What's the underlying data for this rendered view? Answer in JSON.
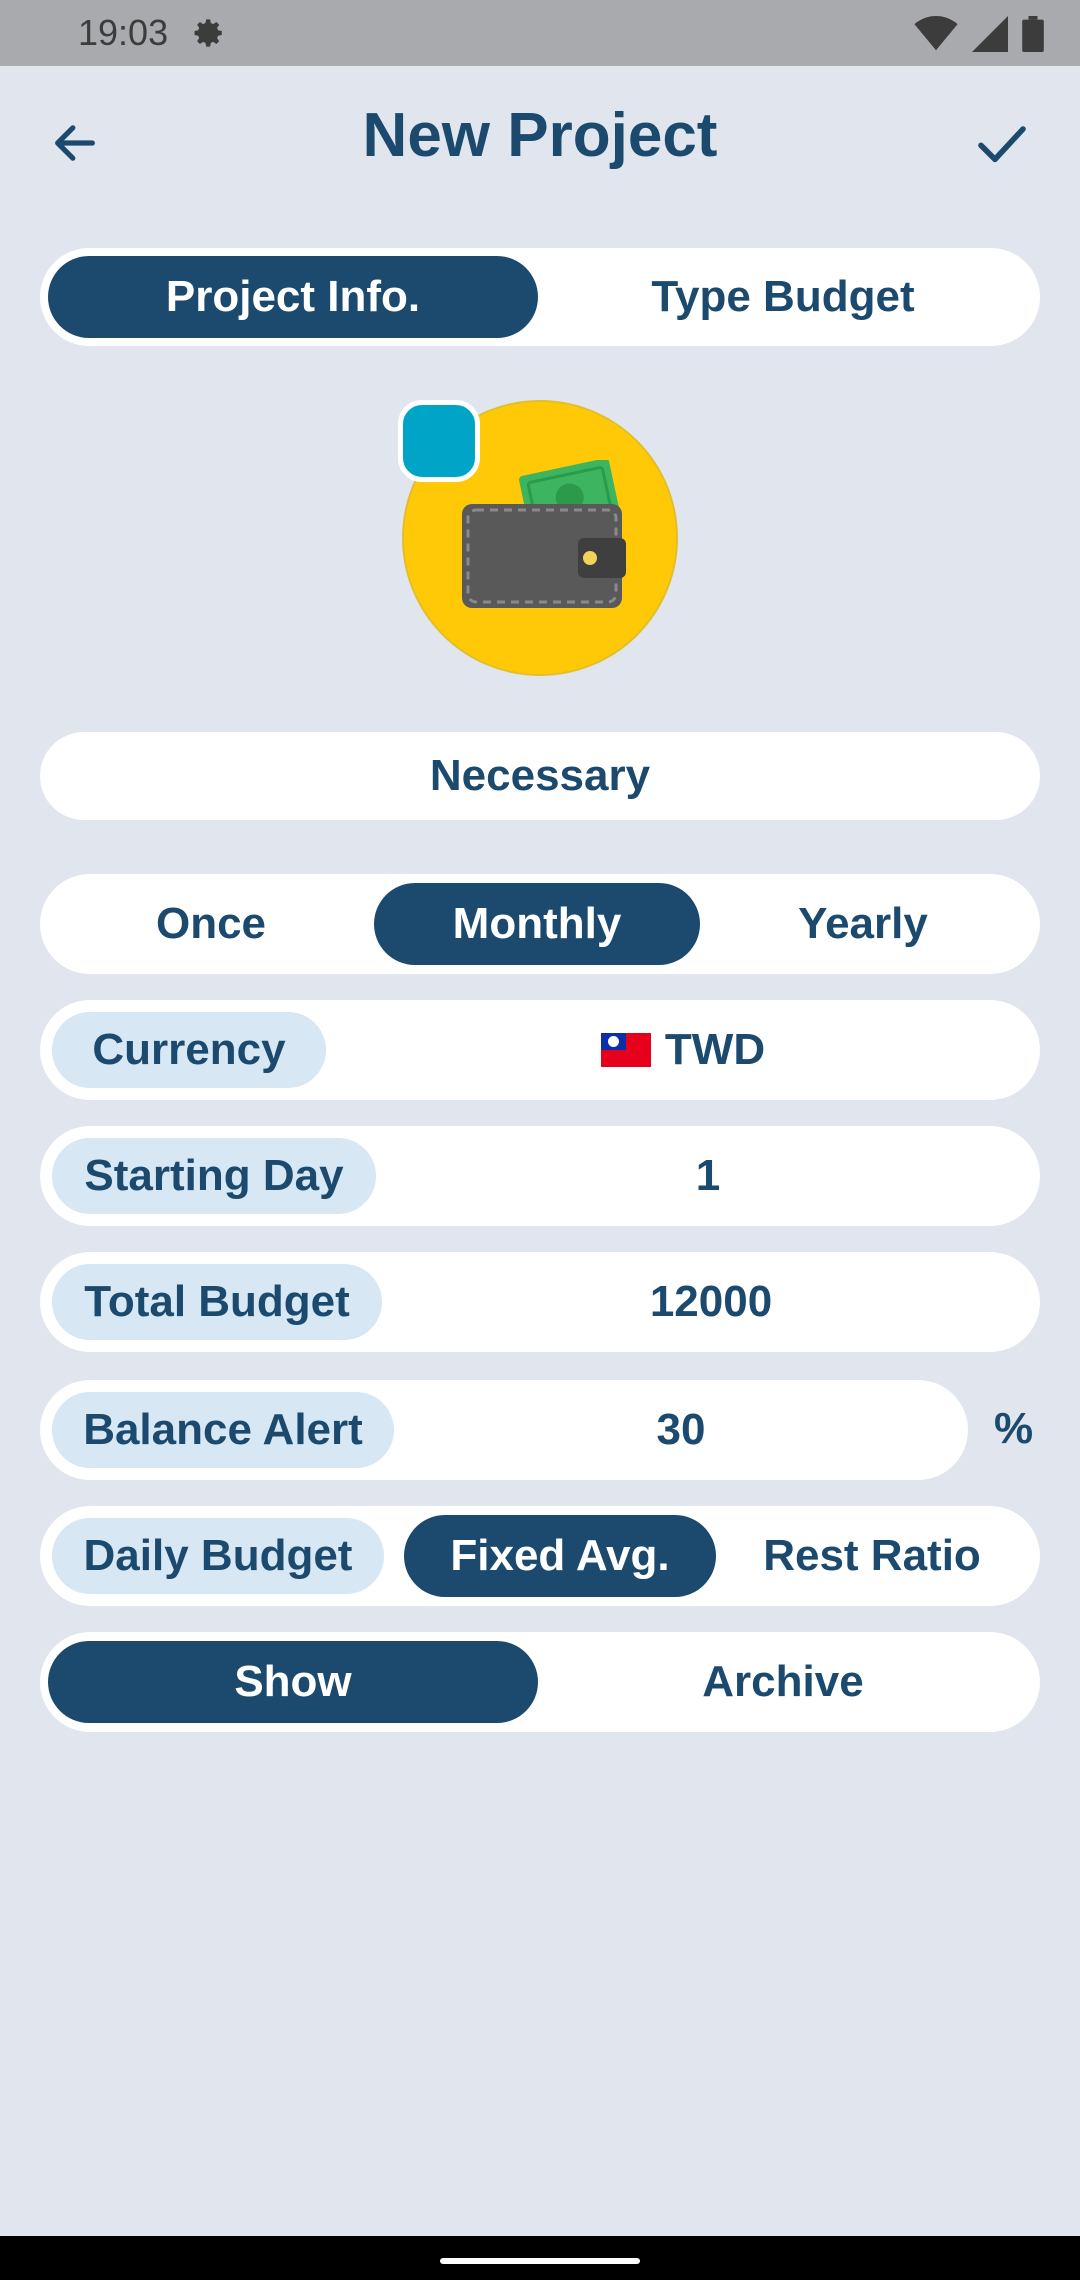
{
  "status_bar": {
    "time": "19:03"
  },
  "header": {
    "title": "New Project"
  },
  "top_tabs": {
    "items": [
      "Project Info.",
      "Type Budget"
    ],
    "active_index": 0
  },
  "project": {
    "name": "Necessary",
    "icon": "wallet-icon",
    "badge_color": "#00A4C6"
  },
  "frequency": {
    "options": [
      "Once",
      "Monthly",
      "Yearly"
    ],
    "active_index": 1
  },
  "fields": {
    "currency": {
      "label": "Currency",
      "value": "TWD",
      "flag": "taiwan-flag"
    },
    "starting_day": {
      "label": "Starting Day",
      "value": "1"
    },
    "total_budget": {
      "label": "Total Budget",
      "value": "12000"
    },
    "balance_alert": {
      "label": "Balance Alert",
      "value": "30",
      "unit": "%"
    }
  },
  "daily_budget": {
    "label": "Daily Budget",
    "options": [
      "Fixed Avg.",
      "Rest Ratio"
    ],
    "active_index": 0
  },
  "visibility": {
    "options": [
      "Show",
      "Archive"
    ],
    "active_index": 0
  },
  "colors": {
    "primary": "#1C4A6E",
    "chip": "#D7E7F3",
    "background": "#E1E6EE",
    "avatar_bg": "#FFC907"
  }
}
